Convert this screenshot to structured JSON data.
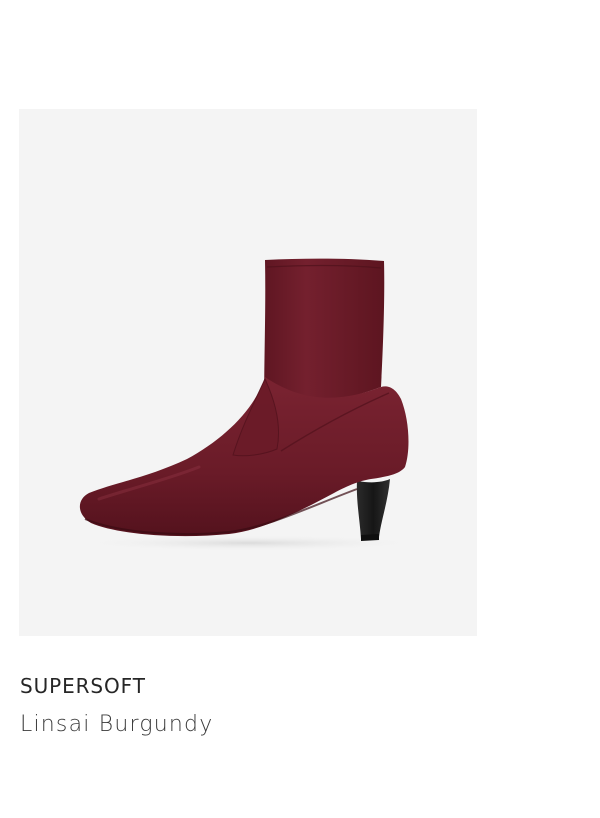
{
  "product": {
    "brand": "SUPERSOFT",
    "name": "Linsai Burgundy",
    "image": {
      "subject": "boot-icon",
      "background_color": "#f4f4f4",
      "boot_color": "#6e1d2a",
      "heel_color": "#1e1e1e"
    }
  }
}
